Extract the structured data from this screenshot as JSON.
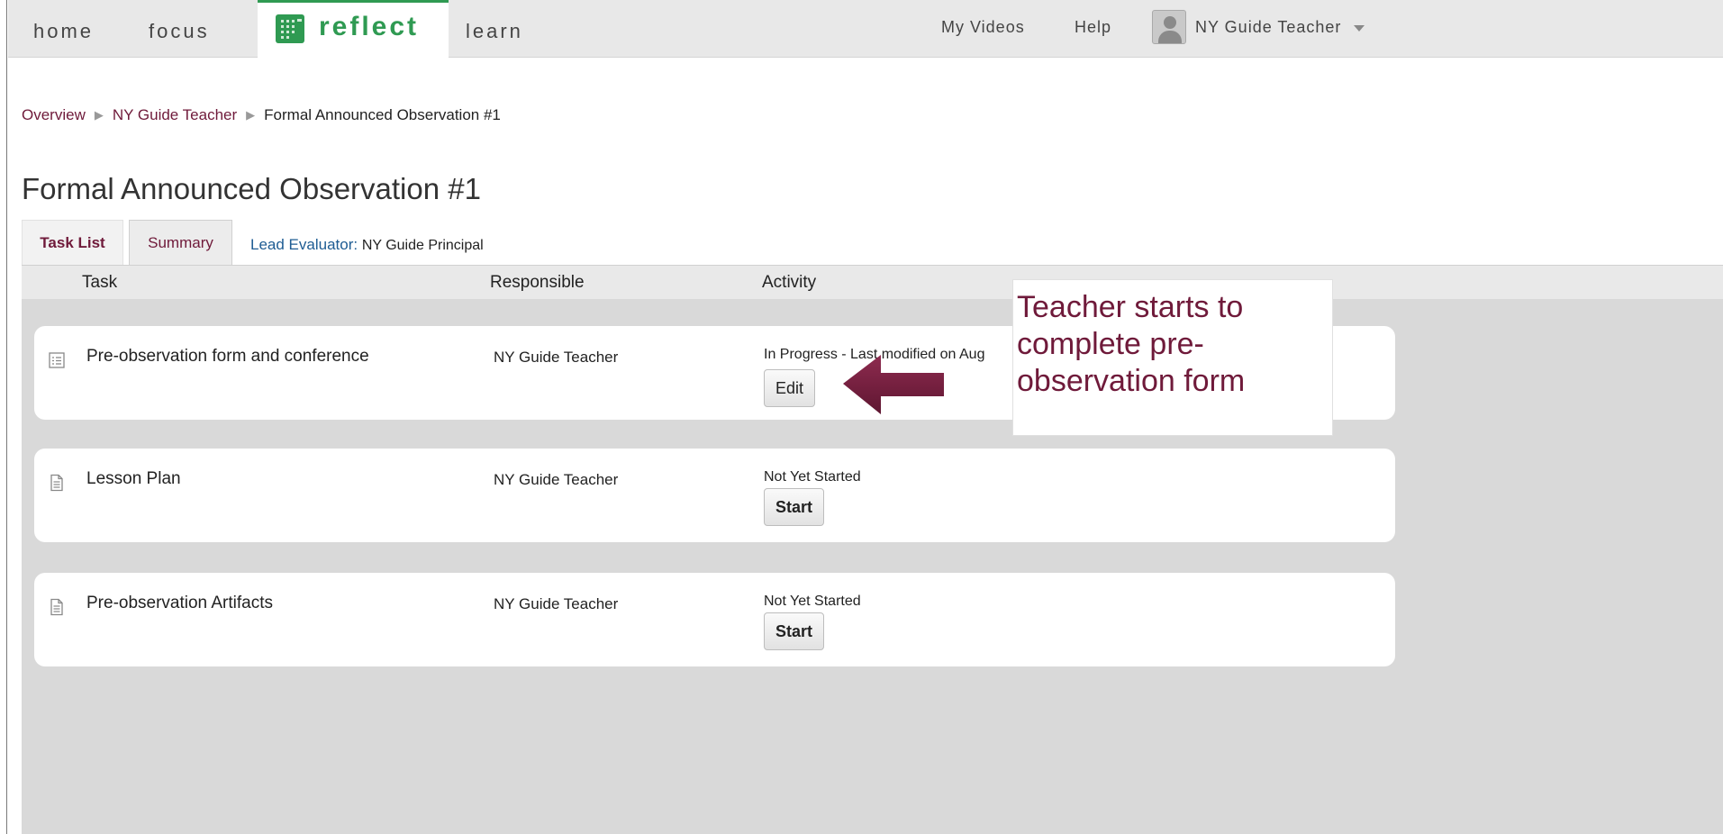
{
  "nav": {
    "home": "home",
    "focus": "focus",
    "reflect": "reflect",
    "learn": "learn",
    "my_videos": "My Videos",
    "help": "Help",
    "user": "NY Guide Teacher"
  },
  "breadcrumb": {
    "items": [
      "Overview",
      "NY Guide Teacher",
      "Formal Announced Observation #1"
    ]
  },
  "page": {
    "title": "Formal Announced Observation #1"
  },
  "tabs": {
    "task_list": "Task List",
    "summary": "Summary"
  },
  "evaluator": {
    "label": "Lead Evaluator:",
    "value": "NY Guide Principal"
  },
  "table": {
    "headers": [
      "Task",
      "Responsible",
      "Activity"
    ],
    "rows": [
      {
        "task": "Pre-observation form and conference",
        "responsible": "NY Guide Teacher",
        "activity": "In Progress - Last modified on Aug",
        "button": "Edit",
        "icon": "form-list-icon"
      },
      {
        "task": "Lesson Plan",
        "responsible": "NY Guide Teacher",
        "activity": "Not Yet Started",
        "button": "Start",
        "icon": "document-icon"
      },
      {
        "task": "Pre-observation Artifacts",
        "responsible": "NY Guide Teacher",
        "activity": "Not Yet Started",
        "button": "Start",
        "icon": "document-icon"
      }
    ]
  },
  "callout": {
    "text": "Teacher starts to complete pre-observation form",
    "line1": "Teacher starts to",
    "line2": "complete pre-",
    "line3": "observation form"
  },
  "colors": {
    "brand_green": "#2f9a52",
    "accent_maroon": "#6f1a3a",
    "link_blue": "#1e5c93"
  }
}
